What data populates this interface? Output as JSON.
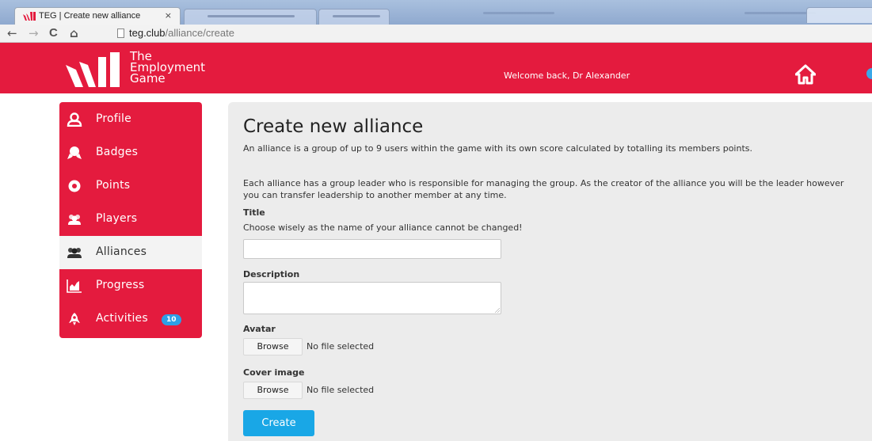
{
  "browser": {
    "tab_title": "TEG | Create new alliance",
    "tab_close": "×",
    "url_host": "teg.club",
    "url_path": "/alliance/create",
    "nav": {
      "back": "←",
      "forward": "→",
      "reload": "C",
      "home": "⌂"
    }
  },
  "header": {
    "logo_line1": "The",
    "logo_line2": "Employment",
    "logo_line3": "Game",
    "welcome": "Welcome back, Dr Alexander",
    "brand_color": "#e41b3e"
  },
  "sidebar": {
    "items": [
      {
        "label": "Profile",
        "icon": "user-icon"
      },
      {
        "label": "Badges",
        "icon": "badge-icon"
      },
      {
        "label": "Points",
        "icon": "target-icon"
      },
      {
        "label": "Players",
        "icon": "players-icon"
      },
      {
        "label": "Alliances",
        "icon": "alliance-icon",
        "active": true
      },
      {
        "label": "Progress",
        "icon": "chart-icon"
      },
      {
        "label": "Activities",
        "icon": "rocket-icon",
        "badge": "10"
      }
    ]
  },
  "main": {
    "title": "Create new alliance",
    "intro": "An alliance is a group of up to 9 users within the game with its own score calculated by totalling its members points.",
    "leader_text": "Each alliance has a group leader who is responsible for managing the group. As the creator of the alliance you will be the leader however you can transfer leadership to another member at any time.",
    "title_label": "Title",
    "title_hint": "Choose wisely as the name of your alliance cannot be changed!",
    "title_value": "",
    "description_label": "Description",
    "description_value": "",
    "avatar_label": "Avatar",
    "avatar_browse": "Browse",
    "avatar_status": "No file selected",
    "cover_label": "Cover image",
    "cover_browse": "Browse",
    "cover_status": "No file selected",
    "create_button": "Create",
    "accent_color": "#19a7e6"
  }
}
